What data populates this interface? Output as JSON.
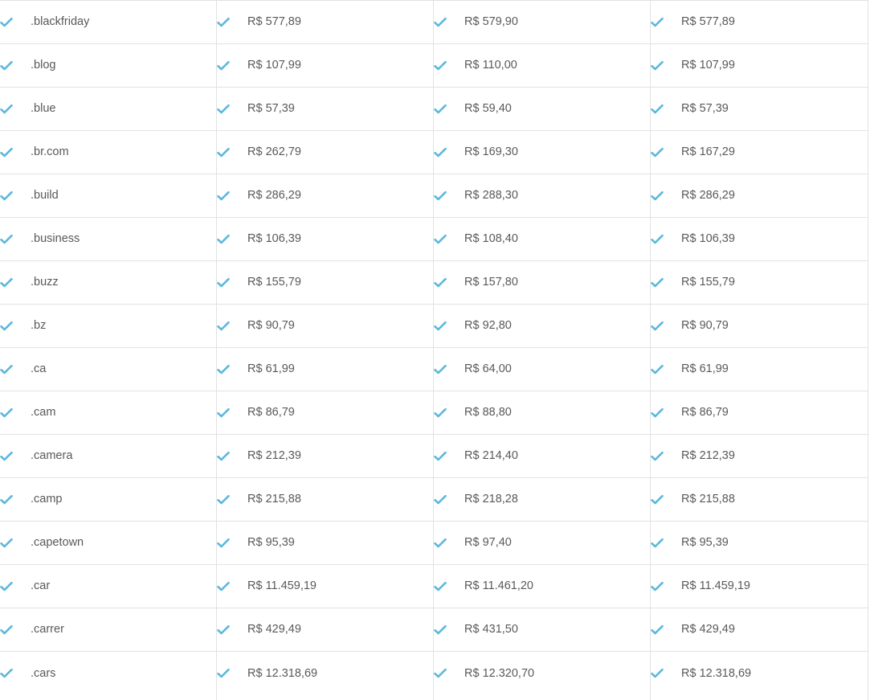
{
  "colors": {
    "check": "#5bb8dd",
    "text": "#595959",
    "border": "#e2e2e2"
  },
  "icons": {
    "check": "check-icon"
  },
  "rows": [
    {
      "tld": ".blackfriday",
      "p1": "R$ 577,89",
      "p2": "R$ 579,90",
      "p3": "R$ 577,89"
    },
    {
      "tld": ".blog",
      "p1": "R$ 107,99",
      "p2": "R$ 110,00",
      "p3": "R$ 107,99"
    },
    {
      "tld": ".blue",
      "p1": "R$ 57,39",
      "p2": "R$ 59,40",
      "p3": "R$ 57,39"
    },
    {
      "tld": ".br.com",
      "p1": "R$ 262,79",
      "p2": "R$ 169,30",
      "p3": "R$ 167,29"
    },
    {
      "tld": ".build",
      "p1": "R$ 286,29",
      "p2": "R$ 288,30",
      "p3": "R$ 286,29"
    },
    {
      "tld": ".business",
      "p1": "R$ 106,39",
      "p2": "R$ 108,40",
      "p3": "R$ 106,39"
    },
    {
      "tld": ".buzz",
      "p1": "R$ 155,79",
      "p2": "R$ 157,80",
      "p3": "R$ 155,79"
    },
    {
      "tld": ".bz",
      "p1": "R$ 90,79",
      "p2": "R$ 92,80",
      "p3": "R$ 90,79"
    },
    {
      "tld": ".ca",
      "p1": "R$ 61,99",
      "p2": "R$ 64,00",
      "p3": "R$ 61,99"
    },
    {
      "tld": ".cam",
      "p1": "R$ 86,79",
      "p2": "R$ 88,80",
      "p3": "R$ 86,79"
    },
    {
      "tld": ".camera",
      "p1": "R$ 212,39",
      "p2": "R$ 214,40",
      "p3": "R$ 212,39"
    },
    {
      "tld": ".camp",
      "p1": "R$ 215,88",
      "p2": "R$ 218,28",
      "p3": "R$ 215,88"
    },
    {
      "tld": ".capetown",
      "p1": "R$ 95,39",
      "p2": "R$ 97,40",
      "p3": "R$ 95,39"
    },
    {
      "tld": ".car",
      "p1": "R$ 11.459,19",
      "p2": "R$ 11.461,20",
      "p3": "R$ 11.459,19"
    },
    {
      "tld": ".carrer",
      "p1": "R$ 429,49",
      "p2": "R$ 431,50",
      "p3": "R$ 429,49"
    },
    {
      "tld": ".cars",
      "p1": "R$ 12.318,69",
      "p2": "R$ 12.320,70",
      "p3": "R$ 12.318,69"
    }
  ]
}
